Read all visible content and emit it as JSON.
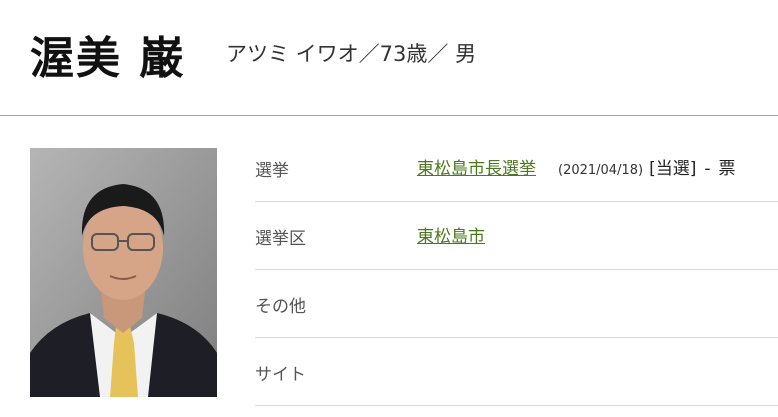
{
  "profile": {
    "name": "渥美 巌",
    "kana_age_gender": "アツミ イワオ／73歳／ 男"
  },
  "details": {
    "election_label": "選挙",
    "election_link": "東松島市長選挙",
    "election_date": "(2021/04/18)",
    "election_result": "[当選]",
    "election_dash": "-",
    "election_votes": "票",
    "district_label": "選挙区",
    "district_link": "東松島市",
    "other_label": "その他",
    "site_label": "サイト"
  },
  "colors": {
    "accent_line": "#8cc063",
    "link": "#4a7a1d"
  }
}
